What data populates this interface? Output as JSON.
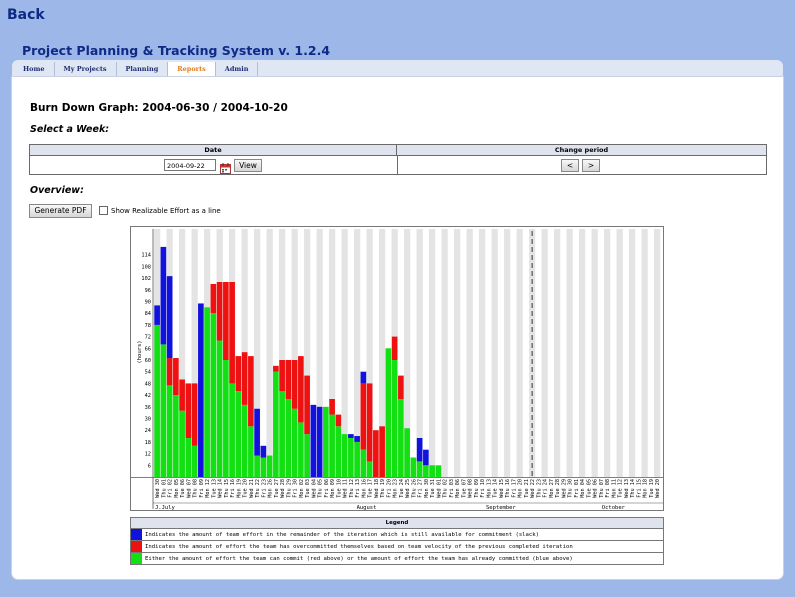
{
  "nav": {
    "back_label": "Back"
  },
  "app_title": "Project Planning & Tracking System v. 1.2.4",
  "tabs": [
    {
      "label": "Home",
      "active": false
    },
    {
      "label": "My Projects",
      "active": false
    },
    {
      "label": "Planning",
      "active": false
    },
    {
      "label": "Reports",
      "active": true
    },
    {
      "label": "Admin",
      "active": false
    }
  ],
  "page": {
    "heading": "Burn Down Graph: 2004-06-30 / 2004-10-20",
    "select_week_label": "Select a Week:",
    "table_headers": {
      "date": "Date",
      "change_period": "Change period"
    },
    "date_value": "2004-09-22",
    "view_button": "View",
    "prev_button": "<",
    "next_button": ">",
    "overview_label": "Overview:",
    "generate_pdf_button": "Generate PDF",
    "realizable_checkbox_label": "Show Realizable Effort as a line",
    "realizable_checked": false
  },
  "chart_data": {
    "type": "bar",
    "stacked": true,
    "ylabel": "(hours)",
    "yticks": [
      6,
      12,
      18,
      24,
      30,
      36,
      42,
      48,
      54,
      60,
      66,
      72,
      78,
      84,
      90,
      96,
      102,
      108,
      114
    ],
    "ylim": [
      0,
      120
    ],
    "current_week_marker": "Wed 22",
    "months": [
      {
        "label": "J.July",
        "start": 0
      },
      {
        "label": "August",
        "start": 23
      },
      {
        "label": "September",
        "start": 45
      },
      {
        "label": "October",
        "start": 66
      }
    ],
    "categories": [
      "Wed 30",
      "Thu 01",
      "Fri 02",
      "Mon 05",
      "Tue 06",
      "Wed 07",
      "Thu 08",
      "Fri 09",
      "Mon 12",
      "Tue 13",
      "Wed 14",
      "Thu 15",
      "Fri 16",
      "Mon 19",
      "Tue 20",
      "Wed 21",
      "Thu 22",
      "Fri 23",
      "Mon 26",
      "Tue 27",
      "Wed 28",
      "Thu 29",
      "Fri 30",
      "Mon 02",
      "Tue 03",
      "Wed 04",
      "Thu 05",
      "Fri 06",
      "Mon 09",
      "Tue 10",
      "Wed 11",
      "Thu 12",
      "Fri 13",
      "Mon 16",
      "Tue 17",
      "Wed 18",
      "Thu 19",
      "Fri 20",
      "Mon 23",
      "Tue 24",
      "Wed 25",
      "Thu 26",
      "Fri 27",
      "Mon 30",
      "Tue 31",
      "Wed 01",
      "Thu 02",
      "Fri 03",
      "Mon 06",
      "Tue 07",
      "Wed 08",
      "Thu 09",
      "Fri 10",
      "Mon 13",
      "Tue 14",
      "Wed 15",
      "Thu 16",
      "Fri 17",
      "Mon 20",
      "Tue 21",
      "Wed 22",
      "Thu 23",
      "Fri 24",
      "Mon 27",
      "Tue 28",
      "Wed 29",
      "Thu 30",
      "Fri 01",
      "Mon 04",
      "Tue 05",
      "Wed 06",
      "Thu 07",
      "Fri 08",
      "Mon 11",
      "Tue 12",
      "Wed 13",
      "Thu 14",
      "Fri 15",
      "Mon 18",
      "Tue 19",
      "Wed 20"
    ],
    "series": [
      {
        "name": "green",
        "values": [
          78,
          68,
          47,
          42,
          34,
          20,
          16,
          0,
          87,
          84,
          70,
          60,
          48,
          44,
          37,
          26,
          11,
          10,
          11,
          54,
          44,
          40,
          35,
          28,
          22,
          8,
          0,
          36,
          32,
          26,
          22,
          20,
          18,
          14,
          8,
          0,
          0,
          66,
          60,
          40,
          25,
          10,
          8,
          6,
          6,
          6,
          0,
          0,
          0,
          0,
          0,
          0,
          0,
          0,
          0,
          0,
          0,
          0,
          0,
          0,
          0,
          0,
          0,
          0,
          0,
          0,
          0,
          0,
          0,
          0,
          0,
          0,
          0,
          0,
          0,
          0,
          0,
          0,
          0,
          0,
          0
        ]
      },
      {
        "name": "red",
        "values": [
          0,
          0,
          14,
          19,
          16,
          28,
          32,
          13,
          0,
          15,
          30,
          40,
          52,
          18,
          27,
          36,
          0,
          0,
          0,
          3,
          16,
          20,
          25,
          34,
          30,
          43,
          0,
          0,
          8,
          6,
          0,
          0,
          0,
          34,
          40,
          24,
          26,
          0,
          12,
          12,
          0,
          0,
          0,
          0,
          0,
          0,
          0,
          0,
          0,
          0,
          0,
          0,
          0,
          0,
          0,
          0,
          0,
          0,
          0,
          0,
          0,
          0,
          0,
          0,
          0,
          0,
          0,
          0,
          0,
          0,
          0,
          0,
          0,
          0,
          0,
          0,
          0,
          0,
          0,
          0,
          0
        ]
      },
      {
        "name": "blue",
        "values": [
          10,
          50,
          42,
          0,
          0,
          0,
          0,
          0,
          0,
          0,
          0,
          0,
          0,
          0,
          0,
          0,
          24,
          6,
          0,
          0,
          0,
          0,
          0,
          0,
          0,
          0,
          36,
          0,
          0,
          0,
          0,
          2,
          3,
          6,
          0,
          0,
          0,
          0,
          0,
          0,
          0,
          0,
          12,
          8,
          0,
          0,
          0,
          0,
          0,
          0,
          0,
          0,
          0,
          0,
          0,
          0,
          0,
          0,
          0,
          0,
          0,
          0,
          0,
          0,
          0,
          0,
          0,
          0,
          0,
          0,
          0,
          0,
          0,
          0,
          0,
          0,
          0,
          0,
          0,
          0,
          0
        ]
      }
    ],
    "blue_only_bars": {
      "Fri 09": 89,
      "Wed 04": 37
    },
    "colors": {
      "green": "#12e012",
      "red": "#ee1111",
      "blue": "#1212dd",
      "stripe": "#e4e4e4"
    }
  },
  "legend": {
    "title": "Legend",
    "items": [
      {
        "color": "#1212dd",
        "text": "Indicates the amount of team effort in the remainder of the iteration which is still available for commitment (slack)"
      },
      {
        "color": "#ee1111",
        "text": "Indicates the amount of effort the team has overcommitted themselves based on team velocity of the previous completed iteration"
      },
      {
        "color": "#12e012",
        "text": "Either the amount of effort the team can commit (red above) or the amount of effort the team has already committed (blue above)"
      }
    ]
  }
}
